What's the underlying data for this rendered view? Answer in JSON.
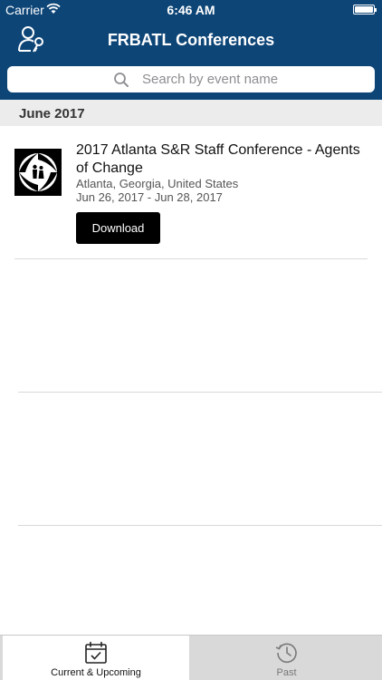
{
  "status_bar": {
    "carrier": "Carrier",
    "time": "6:46 AM",
    "battery_level": 1.0
  },
  "header": {
    "title": "FRBATL Conferences",
    "account_icon": "user-key-icon",
    "background_color": "#0d4577"
  },
  "search": {
    "placeholder": "Search by event name",
    "value": ""
  },
  "sections": [
    {
      "title": "June 2017",
      "events": [
        {
          "title": "2017 Atlanta S&R Staff Conference - Agents of Change",
          "location": "Atlanta, Georgia, United States",
          "dates": "Jun 26, 2017 - Jun 28, 2017",
          "action_label": "Download",
          "thumbnail_icon": "spy-agents-logo"
        }
      ]
    }
  ],
  "tabs": [
    {
      "label": "Current & Upcoming",
      "icon": "calendar-check-icon",
      "active": true
    },
    {
      "label": "Past",
      "icon": "history-clock-icon",
      "active": false
    }
  ]
}
